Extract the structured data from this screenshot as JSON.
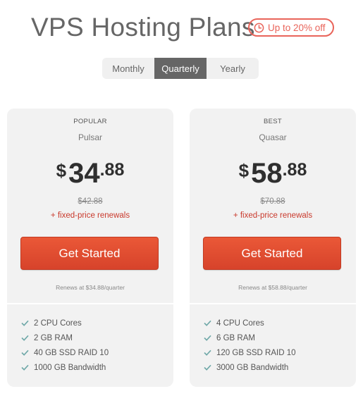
{
  "header": {
    "title": "VPS Hosting Plans",
    "discount_badge": "Up to 20% off"
  },
  "billing_toggle": {
    "options": [
      "Monthly",
      "Quarterly",
      "Yearly"
    ],
    "selected": "Quarterly"
  },
  "plans": [
    {
      "tag": "POPULAR",
      "name": "Pulsar",
      "currency": "$",
      "price_whole": "34",
      "price_cents": ".88",
      "old_price": "$42.88",
      "renewal_note": "+ fixed-price renewals",
      "cta_label": "Get Started",
      "renews_text": "Renews at $34.88/quarter",
      "features": [
        "2 CPU Cores",
        "2 GB RAM",
        "40 GB SSD RAID 10",
        "1000 GB Bandwidth"
      ]
    },
    {
      "tag": "BEST",
      "name": "Quasar",
      "currency": "$",
      "price_whole": "58",
      "price_cents": ".88",
      "old_price": "$70.88",
      "renewal_note": "+ fixed-price renewals",
      "cta_label": "Get Started",
      "renews_text": "Renews at $58.88/quarter",
      "features": [
        "4 CPU Cores",
        "6 GB RAM",
        "120 GB SSD RAID 10",
        "3000 GB Bandwidth"
      ]
    }
  ],
  "icons": {
    "badge_icon": "clock-icon",
    "feature_icon": "check-icon"
  },
  "colors": {
    "accent": "#e9645a",
    "cta": "#e04c30",
    "toggle_active": "#666666",
    "check": "#6fa8a8"
  }
}
